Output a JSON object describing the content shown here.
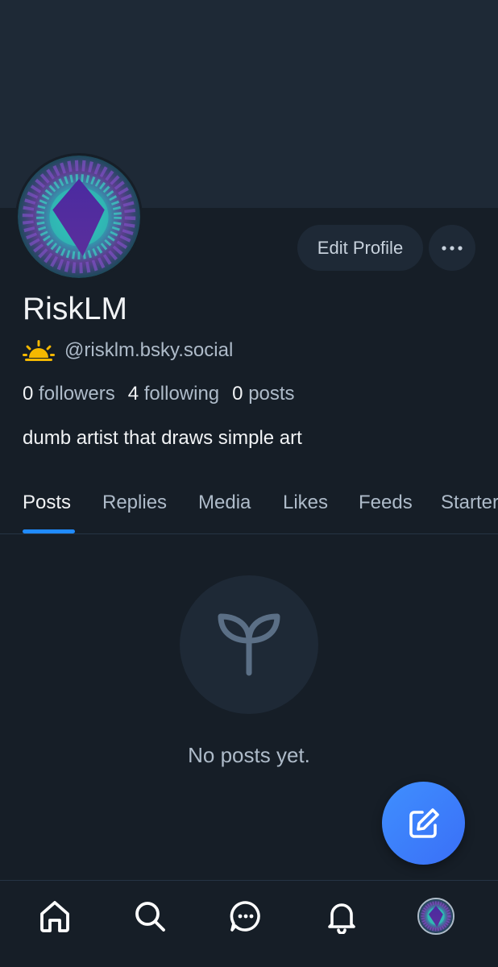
{
  "profile": {
    "display_name": "RiskLM",
    "handle": "@risklm.bsky.social",
    "bio": "dumb artist that draws simple art",
    "stats": {
      "followers_count": "0",
      "followers_label": "followers",
      "following_count": "4",
      "following_label": "following",
      "posts_count": "0",
      "posts_label": "posts"
    }
  },
  "actions": {
    "edit_profile_label": "Edit Profile"
  },
  "tabs": [
    {
      "label": "Posts",
      "active": true
    },
    {
      "label": "Replies",
      "active": false
    },
    {
      "label": "Media",
      "active": false
    },
    {
      "label": "Likes",
      "active": false
    },
    {
      "label": "Feeds",
      "active": false
    },
    {
      "label": "Starter Packs",
      "active": false
    }
  ],
  "empty_state": {
    "icon": "sprout-icon",
    "text": "No posts yet."
  },
  "bottom_nav": [
    {
      "icon": "home-icon"
    },
    {
      "icon": "search-icon"
    },
    {
      "icon": "chat-icon"
    },
    {
      "icon": "bell-icon"
    },
    {
      "icon": "avatar"
    }
  ],
  "colors": {
    "background": "#161e27",
    "banner": "#1e2936",
    "accent": "#208bfe",
    "fab": "#3f8ffe",
    "muted_text": "#aebbc9"
  }
}
